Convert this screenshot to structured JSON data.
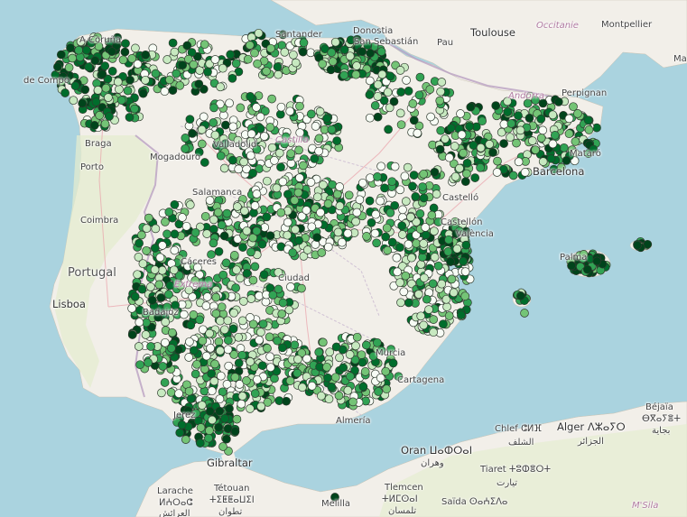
{
  "map": {
    "colors": {
      "sea": "#aad3df",
      "land": "#f2efe9",
      "land_green": "#e4eccf",
      "border": "#b9a0c2",
      "road": "#e9a0a8",
      "dot_outline": "#2f3a2f",
      "dot_scale": [
        "#f7fcf5",
        "#c7e9c0",
        "#74c476",
        "#31a354",
        "#006d2c",
        "#00441b"
      ]
    },
    "labels": {
      "country_portugal": "Portugal",
      "city_toulouse": "Toulouse",
      "region_occitanie": "Occitanie",
      "city_montpellier": "Montpellier",
      "city_perpignan": "Perpignan",
      "region_andorra": "Andorra",
      "city_santander": "Santander",
      "city_donostia": "Donostia",
      "city_san_sebastian": "San Sebastián",
      "city_pau": "Pau",
      "city_a_coruna": "A Coruña",
      "city_santiago": "de Compo",
      "city_braga": "Braga",
      "city_porto": "Porto",
      "city_coimbra": "Coimbra",
      "city_lisboa": "Lisboa",
      "city_mogadouro": "Mogadouro",
      "city_valladolid": "Valladolid",
      "region_castilla": "Castilla",
      "city_salamanca": "Salamanca",
      "city_castellon": "Castellón",
      "city_castello": "Castelló",
      "city_valencia": "València",
      "city_barcelona": "Barcelona",
      "city_mataro": "Mataró",
      "city_palma": "Palma",
      "city_ciudad": "Ciudad",
      "city_caceres": "Cáceres",
      "region_extremadura": "Extrema",
      "city_badajoz": "Badajoz",
      "city_murcia": "Murcia",
      "city_cartagena": "Cartagena",
      "city_almeria": "Almería",
      "city_jerez": "Jerez",
      "city_gibraltar": "Gibraltar",
      "city_oran_latin": "Oran",
      "city_oran_tifinagh": "ⵡⴰⵀⵔⴰⵏ",
      "city_oran_arabic": "وهران",
      "city_tlemcen": "Tlemcen",
      "city_tlemcen_tifinagh": "ⵜⵍⵎⵙⴰⵏ",
      "city_tlemcen_arabic": "تلمسان",
      "city_chlef": "Chlef ⵛⵍⴼ",
      "city_chlef_arabic": "الشلف",
      "city_alger": "Alger ⴷⵣⴰⵢⵔ",
      "city_alger_arabic": "الجزائر",
      "city_bejaia": "Béjaïa",
      "city_bejaia_tifinagh": "ⴱⴳⴰⵢⴻⵜ",
      "city_bejaia_arabic": "بجاية",
      "city_tiaret": "Tiaret ⵜⵓⵀⴻⵔⵜ",
      "city_tiaret_arabic": "تيارت",
      "city_larache": "Larache",
      "city_larache_tifinagh": "ⵍⵄⵔⴰⵛ",
      "city_larache_arabic": "العرائش",
      "city_tetouan": "Tétouan",
      "city_tetouan_tifinagh": "ⵜⵉⵟⵟⴰⵡⵉⵏ",
      "city_tetouan_arabic": "تطوان",
      "city_melilla": "Melilla",
      "city_saida": "Saïda ⵙⴰⵄⵉⴷⴰ",
      "city_msila": "M'Sila",
      "city_ma": "Ma"
    }
  }
}
